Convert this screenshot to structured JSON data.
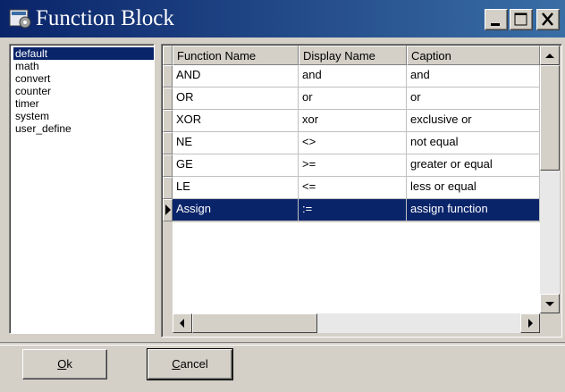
{
  "window": {
    "title": "Function Block"
  },
  "categories": [
    "default",
    "math",
    "convert",
    "counter",
    "timer",
    "system",
    "user_define"
  ],
  "selected_category": "default",
  "table": {
    "columns": [
      "Function Name",
      "Display Name",
      "Caption"
    ],
    "rows": [
      [
        "AND",
        "and",
        "and"
      ],
      [
        "OR",
        "or",
        "or"
      ],
      [
        "XOR",
        "xor",
        "exclusive or"
      ],
      [
        "NE",
        "<>",
        "not equal"
      ],
      [
        "GE",
        ">=",
        "greater or equal"
      ],
      [
        "LE",
        "<=",
        "less or equal"
      ],
      [
        "Assign",
        ":=",
        "assign function"
      ]
    ],
    "selected_row": 6
  },
  "buttons": {
    "ok_mnemonic": "O",
    "ok_rest": "k",
    "cancel_mnemonic": "C",
    "cancel_rest": "ancel"
  },
  "colors": {
    "selection": "#0a246a",
    "title_start": "#0a246a",
    "title_end": "#3a6ea5"
  }
}
